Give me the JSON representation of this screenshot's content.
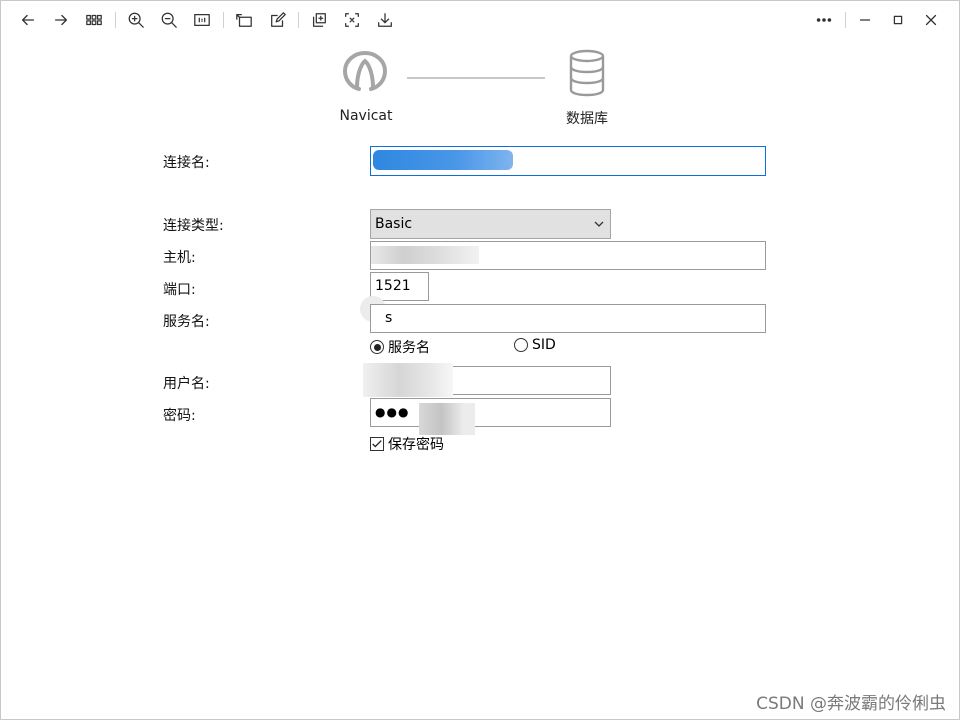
{
  "toolbar": {
    "icons": [
      "back-icon",
      "forward-icon",
      "grid-icon",
      "zoom-in-icon",
      "zoom-out-icon",
      "fit-icon",
      "rotate-icon",
      "edit-icon",
      "copy-icon",
      "crop-icon",
      "download-icon",
      "more-icon",
      "minimize-icon",
      "maximize-icon",
      "close-icon"
    ]
  },
  "header": {
    "left_label": "Navicat",
    "right_label": "数据库"
  },
  "form": {
    "conn_name_label": "连接名:",
    "conn_type_label": "连接类型:",
    "conn_type_value": "Basic",
    "host_label": "主机:",
    "port_label": "端口:",
    "port_value": "1521",
    "service_label": "服务名:",
    "service_value": "s",
    "radio_service": "服务名",
    "radio_sid": "SID",
    "user_label": "用户名:",
    "password_label": "密码:",
    "password_value": "●●●",
    "save_password": "保存密码"
  },
  "watermark": "CSDN @奔波霸的伶俐虫",
  "colors": {
    "focus_border": "#0f6fd6",
    "selection_blue": "#3a8ee6"
  }
}
